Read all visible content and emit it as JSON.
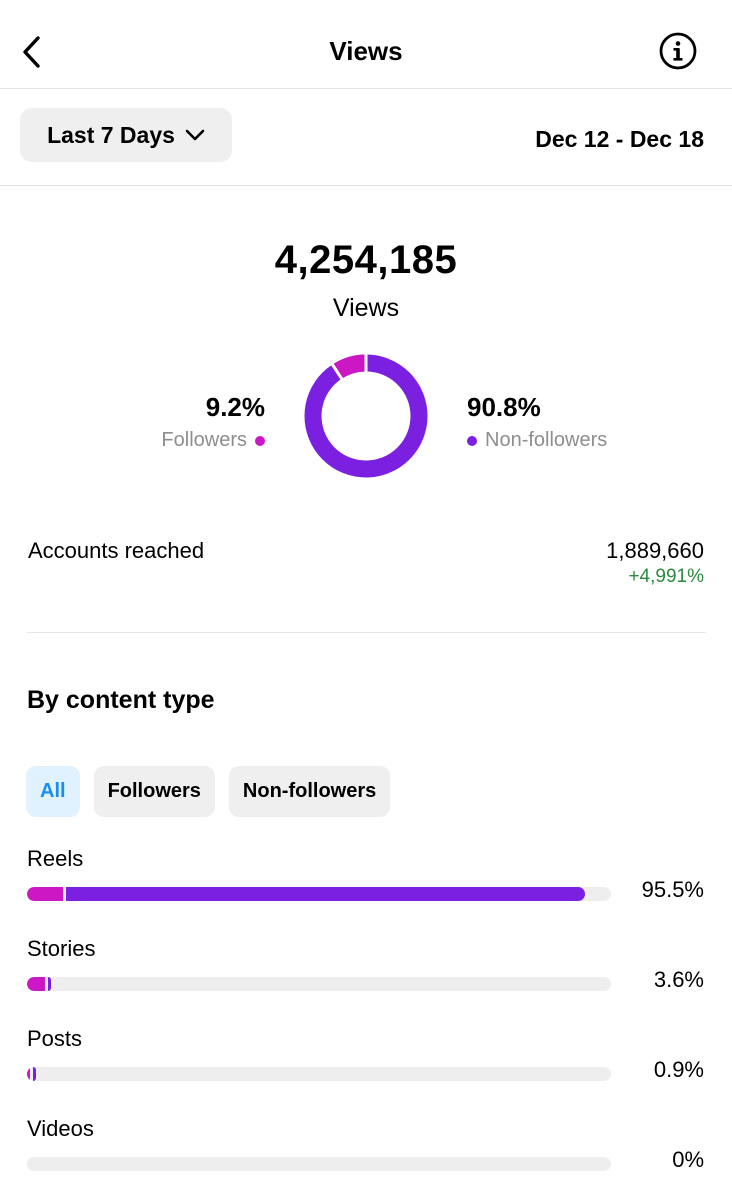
{
  "header": {
    "title": "Views"
  },
  "range": {
    "label": "Last 7 Days",
    "dates": "Dec 12 - Dec 18"
  },
  "totals": {
    "value": "4,254,185",
    "label": "Views"
  },
  "split": {
    "followers": {
      "pct": "9.2%",
      "label": "Followers",
      "value": 9.2,
      "color": "#cc18c4"
    },
    "non_followers": {
      "pct": "90.8%",
      "label": "Non-followers",
      "value": 90.8,
      "color": "#7b1fe0"
    }
  },
  "reach": {
    "label": "Accounts reached",
    "value": "1,889,660",
    "change": "+4,991%"
  },
  "content": {
    "title": "By content type",
    "filters": [
      "All",
      "Followers",
      "Non-followers"
    ],
    "rows": [
      {
        "label": "Reels",
        "pct": "95.5%",
        "value": 95.5,
        "followers_value": 6.1
      },
      {
        "label": "Stories",
        "pct": "3.6%",
        "value": 3.6,
        "followers_value": 3.0
      },
      {
        "label": "Posts",
        "pct": "0.9%",
        "value": 0.9,
        "followers_value": 0.3
      },
      {
        "label": "Videos",
        "pct": "0%",
        "value": 0,
        "followers_value": 0
      }
    ]
  }
}
